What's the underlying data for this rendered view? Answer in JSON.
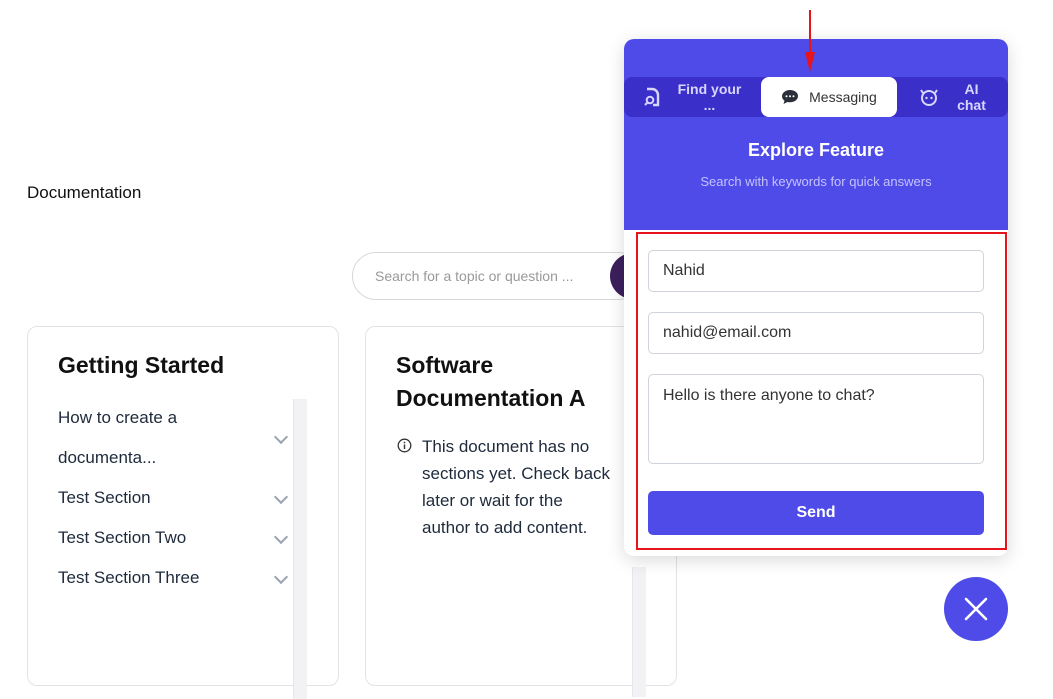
{
  "page": {
    "title": "Documentation",
    "search_placeholder": "Search for a topic or question ..."
  },
  "cards": [
    {
      "title": "Getting Started",
      "sections": [
        "How to create a",
        "documenta...",
        "Test Section",
        "Test Section Two",
        "Test Section Three"
      ]
    },
    {
      "title_line1": "Software",
      "title_line2": "Documentation A",
      "empty_lines": [
        "This document has no",
        "sections yet. Check back",
        "later or wait for the",
        "author to add content."
      ]
    }
  ],
  "widget": {
    "tabs": [
      {
        "label_line1": "Find your",
        "label_line2": "...",
        "icon": "search-doc-icon"
      },
      {
        "label": "Messaging",
        "icon": "chat-bubble-icon",
        "active": true
      },
      {
        "label_line1": "AI",
        "label_line2": "chat",
        "icon": "robot-icon"
      }
    ],
    "title": "Explore Feature",
    "subtitle": "Search with keywords for quick answers",
    "form": {
      "name": "Nahid",
      "email": "nahid@email.com",
      "message": "Hello is there anyone to chat?",
      "send_label": "Send"
    },
    "accent": "#4f4be9"
  },
  "annotations": {
    "highlight_color": "#e8141b"
  }
}
